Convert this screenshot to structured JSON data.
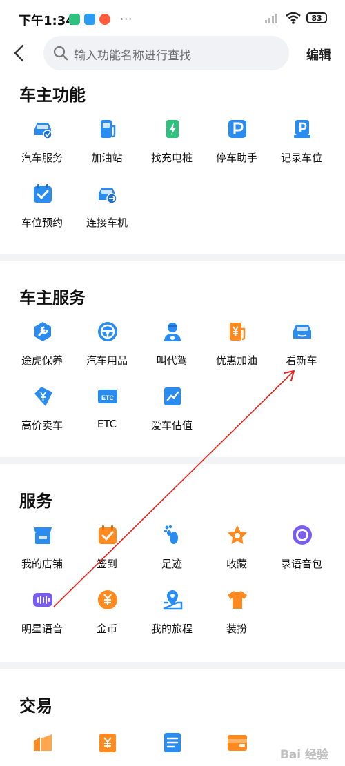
{
  "status_bar": {
    "time": "下午1:34",
    "dots": "···",
    "battery": "83"
  },
  "header": {
    "search_placeholder": "输入功能名称进行查找",
    "edit_label": "编辑"
  },
  "sections": [
    {
      "title": "车主功能",
      "items": [
        {
          "label": "汽车服务",
          "icon": "car-service-icon"
        },
        {
          "label": "加油站",
          "icon": "gas-station-icon"
        },
        {
          "label": "找充电桩",
          "icon": "charging-pile-icon"
        },
        {
          "label": "停车助手",
          "icon": "parking-icon"
        },
        {
          "label": "记录车位",
          "icon": "record-parking-icon"
        },
        {
          "label": "车位预约",
          "icon": "calendar-check-icon"
        },
        {
          "label": "连接车机",
          "icon": "car-link-icon"
        }
      ]
    },
    {
      "title": "车主服务",
      "items": [
        {
          "label": "途虎保养",
          "icon": "wrench-icon"
        },
        {
          "label": "汽车用品",
          "icon": "steering-wheel-icon"
        },
        {
          "label": "叫代驾",
          "icon": "driver-icon"
        },
        {
          "label": "优惠加油",
          "icon": "discount-fuel-icon"
        },
        {
          "label": "看新车",
          "icon": "new-car-icon"
        },
        {
          "label": "高价卖车",
          "icon": "price-tag-icon"
        },
        {
          "label": "ETC",
          "icon": "etc-icon"
        },
        {
          "label": "爱车估值",
          "icon": "valuation-chart-icon"
        }
      ]
    },
    {
      "title": "服务",
      "items": [
        {
          "label": "我的店铺",
          "icon": "store-icon"
        },
        {
          "label": "签到",
          "icon": "check-in-icon"
        },
        {
          "label": "足迹",
          "icon": "footprint-icon"
        },
        {
          "label": "收藏",
          "icon": "star-icon"
        },
        {
          "label": "录语音包",
          "icon": "record-voice-icon"
        },
        {
          "label": "明星语音",
          "icon": "voice-wave-icon"
        },
        {
          "label": "金币",
          "icon": "coin-icon"
        },
        {
          "label": "我的旅程",
          "icon": "map-pin-icon"
        },
        {
          "label": "装扮",
          "icon": "shirt-icon"
        }
      ]
    },
    {
      "title": "交易",
      "items": [
        {
          "label": "",
          "icon": "orange-chart-icon"
        },
        {
          "label": "",
          "icon": "yuan-doc-icon"
        },
        {
          "label": "",
          "icon": "document-icon"
        },
        {
          "label": "",
          "icon": "wallet-icon"
        }
      ]
    }
  ],
  "watermark": "Bai 经验",
  "colors": {
    "blue": "#2b8cf0",
    "orange": "#ff8a1f",
    "green": "#2ec27e",
    "purple": "#7b5cf0"
  }
}
